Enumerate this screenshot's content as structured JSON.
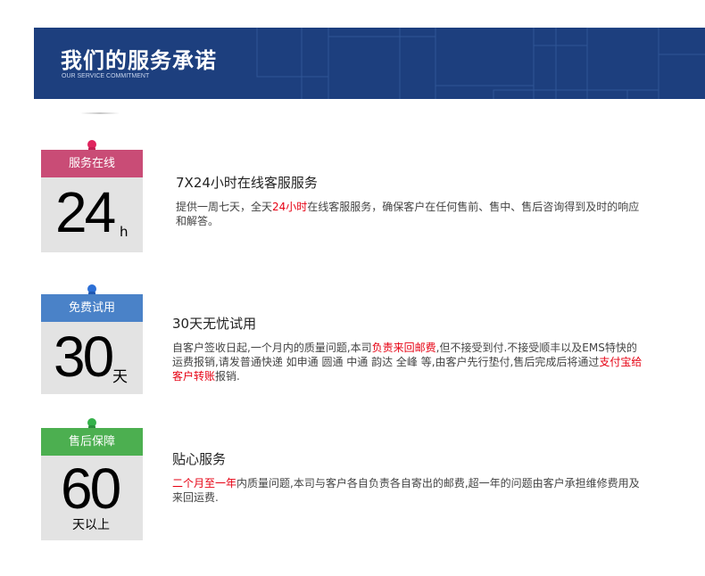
{
  "header": {
    "title": "我们的服务承诺",
    "subtitle": "OUR SERVICE COMMITMENT",
    "bg_color": "#1d3f7e"
  },
  "services": [
    {
      "badge_label": "服务在线",
      "badge_color": "#c94c76",
      "pin_color": "#e0245e",
      "number": "24",
      "unit": "h",
      "title": "7X24小时在线客服服务",
      "desc_parts": [
        "提供一周七天，全天",
        "24小时",
        "在线客服服务，确保客户在任何售前、售中、售后咨询得到及时的响应和解答。"
      ]
    },
    {
      "badge_label": "免费试用",
      "badge_color": "#4a82c8",
      "pin_color": "#2c6fd6",
      "number": "30",
      "unit": "天",
      "title": "30天无忧试用",
      "desc_parts": [
        "自客户签收日起,一个月内的质量问题,本司",
        "负责来回邮费",
        ",但不接受到付.不接受顺丰以及EMS特快的运费报销,请发普通快递 如申通 圆通 中通 韵达 全峰 等,由客户先行垫付,售后完成后将通过",
        "支付宝给客户转账",
        "报销."
      ]
    },
    {
      "badge_label": "售后保障",
      "badge_color": "#4caf50",
      "pin_color": "#35b14a",
      "number": "60",
      "unit": "天以上",
      "title": "贴心服务",
      "desc_parts": [
        "二个月至一年",
        "内质量问题,本司与客户各自负责各自寄出的邮费,超一年的问题由客户承担维修费用及来回运费."
      ]
    }
  ]
}
